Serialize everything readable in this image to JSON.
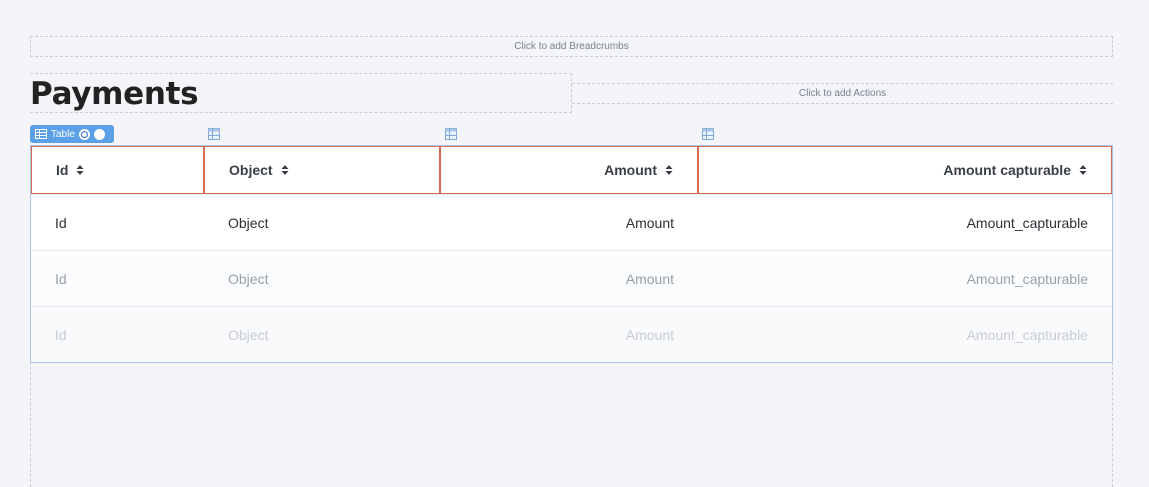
{
  "breadcrumbs_placeholder": "Click to add Breadcrumbs",
  "page_title": "Payments",
  "actions_placeholder": "Click to add Actions",
  "table_badge": {
    "label": "Table"
  },
  "table": {
    "columns": [
      "Id",
      "Object",
      "Amount",
      "Amount capturable"
    ],
    "rows": [
      [
        "Id",
        "Object",
        "Amount",
        "Amount_capturable"
      ],
      [
        "Id",
        "Object",
        "Amount",
        "Amount_capturable"
      ],
      [
        "Id",
        "Object",
        "Amount",
        "Amount_capturable"
      ]
    ]
  },
  "colors": {
    "background": "#f3f5f8",
    "badge": "#5b9fe6",
    "header_border": "#d66a55",
    "table_border": "#a9c6e8"
  }
}
